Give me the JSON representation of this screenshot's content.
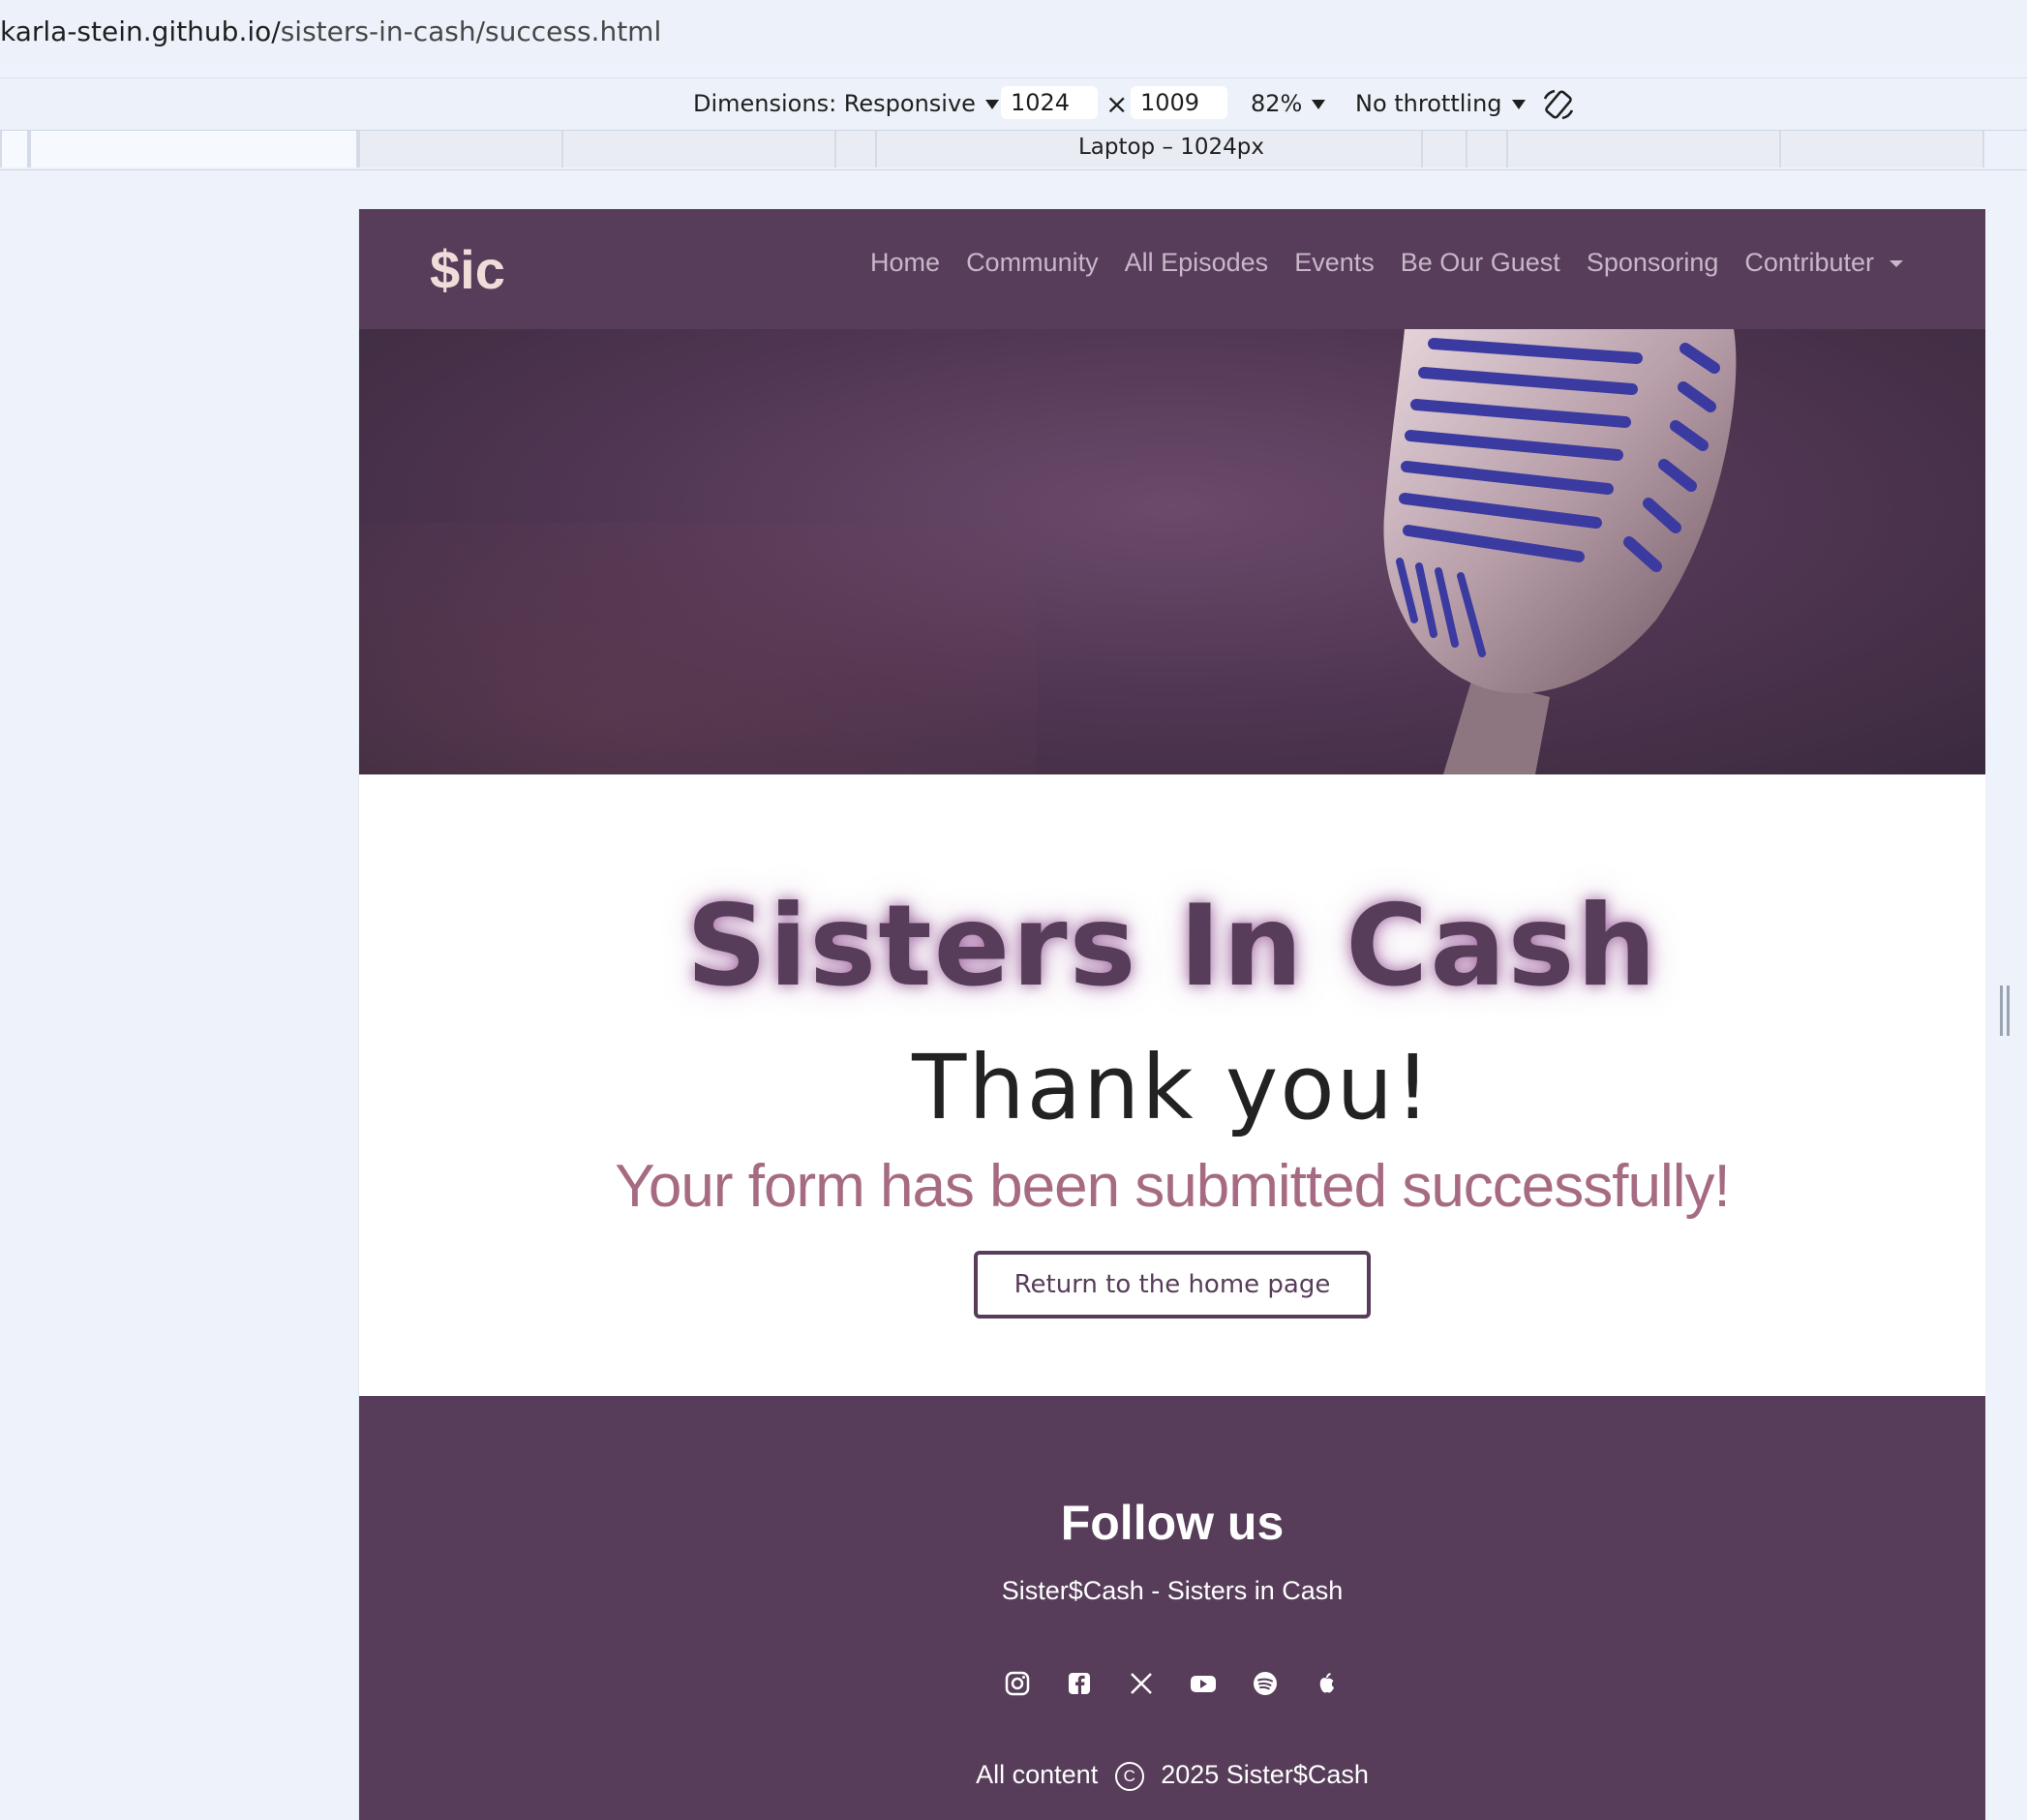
{
  "browser": {
    "url_host": "karla-stein.github.io/",
    "url_path": "sisters-in-cash/success.html"
  },
  "device_toolbar": {
    "dimensions_label": "Dimensions: Responsive",
    "width": "1024",
    "times": "×",
    "height": "1009",
    "zoom": "82%",
    "throttling": "No throttling",
    "media_query_label": "Laptop – 1024px"
  },
  "nav": {
    "brand": "$ic",
    "links": [
      "Home",
      "Community",
      "All Episodes",
      "Events",
      "Be Our Guest",
      "Sponsoring",
      "Contributer"
    ]
  },
  "main": {
    "title": "Sisters In Cash",
    "thanks": "Thank you!",
    "message": "Your form has been submitted successfully!",
    "button": "Return to the home page"
  },
  "footer": {
    "heading": "Follow us",
    "tagline": "Sister$Cash - Sisters in Cash",
    "socials": [
      "instagram-icon",
      "facebook-icon",
      "x-icon",
      "youtube-icon",
      "spotify-icon",
      "apple-icon"
    ],
    "copyright_prefix": "All content",
    "copyright_suffix": "2025 Sister$Cash"
  },
  "colors": {
    "brand_purple": "#573d5a",
    "accent_pink": "#a66b82",
    "brand_logo": "#f0dcd9"
  }
}
